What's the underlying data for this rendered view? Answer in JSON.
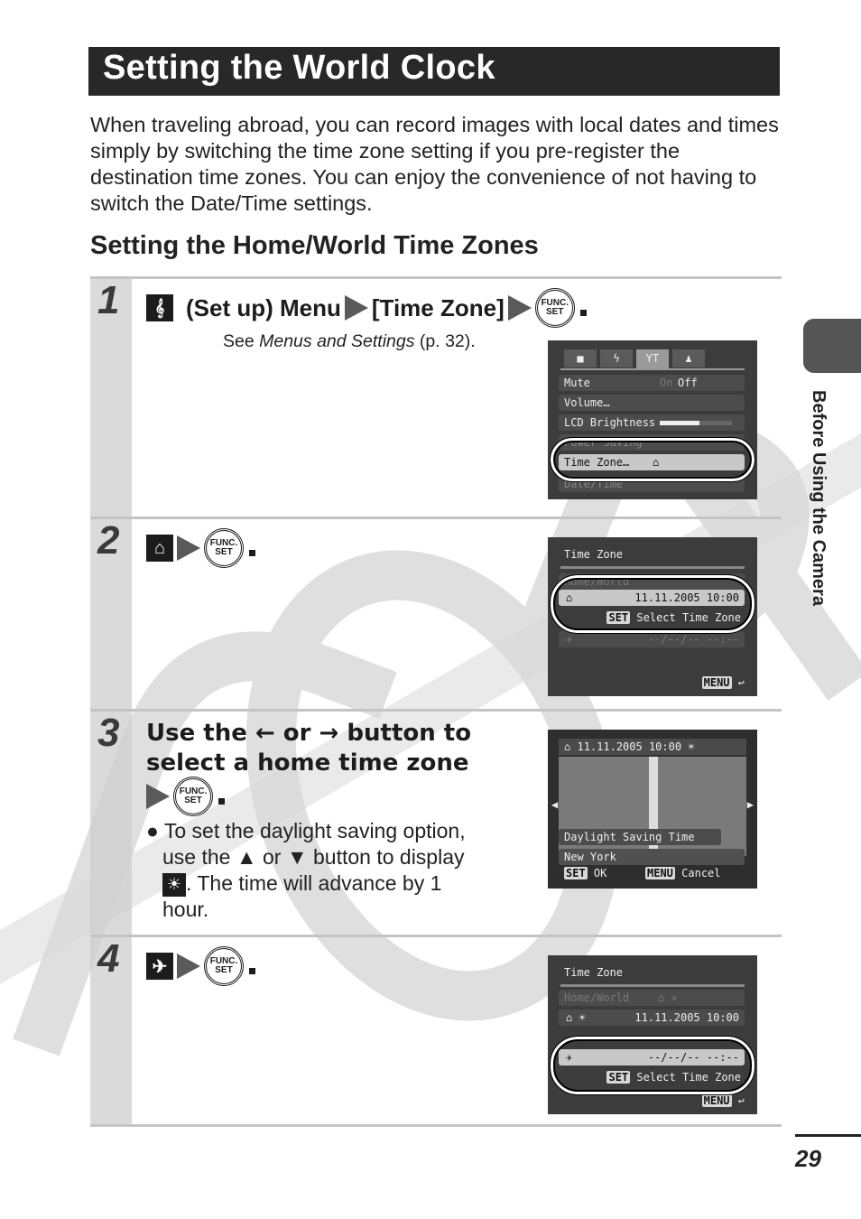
{
  "page": {
    "title": "Setting the World Clock",
    "intro": "When traveling abroad, you can record images with local dates and times simply by switching the time zone setting if you pre-register the destination time zones. You can enjoy the convenience of not having to switch the Date/Time settings.",
    "subheading": "Setting the Home/World Time Zones",
    "side_label": "Before Using the Camera",
    "page_number": "29",
    "watermark": "COPY"
  },
  "steps": [
    {
      "number": "1",
      "instruction_prefix": "(Set up) Menu",
      "instruction_target": "[Time Zone]",
      "icon": "setup-menu-icon",
      "note_prefix": "See ",
      "note_italic": "Menus and Settings",
      "note_suffix": " (p. 32).",
      "screen": {
        "tabs": [
          "camera-icon",
          "flash-icon",
          "setup-icon",
          "mycamera-icon"
        ],
        "rows": [
          {
            "label": "Mute",
            "value_off": "On",
            "value": "Off"
          },
          {
            "label": "Volume…",
            "value": ""
          },
          {
            "label": "LCD Brightness",
            "value": "slider",
            "min": "-",
            "max": "+"
          },
          {
            "label": "Power Saving",
            "value": ""
          },
          {
            "label": "Time Zone…",
            "value": "home-icon"
          },
          {
            "label": "Date/Time",
            "value": ""
          }
        ]
      }
    },
    {
      "number": "2",
      "icon": "home-icon",
      "screen": {
        "title": "Time Zone",
        "rows": [
          {
            "label": "Home/World",
            "value": ""
          },
          {
            "label": "home-icon",
            "value": "11.11.2005 10:00"
          },
          {
            "label": "SET",
            "value": "Select Time Zone"
          },
          {
            "label": "world-icon",
            "value": "--/--/-- --:--"
          }
        ],
        "footer": "MENU"
      }
    },
    {
      "number": "3",
      "instruction_line1_a": "Use the",
      "instruction_line1_b": "or",
      "instruction_line1_c": "button to",
      "instruction_line2": "select a home time zone",
      "bullet_a": "To set the daylight saving option,",
      "bullet_b1": "use the",
      "bullet_b2": "or",
      "bullet_b3": "button to display",
      "bullet_c": ". The time will advance by 1",
      "bullet_d": "hour.",
      "screen": {
        "header": "11.11.2005 10:00",
        "dst_label": "Daylight Saving Time",
        "city": "New York",
        "ok_badge": "SET",
        "ok_label": "OK",
        "cancel_badge": "MENU",
        "cancel_label": "Cancel"
      }
    },
    {
      "number": "4",
      "icon": "airplane-icon",
      "screen": {
        "title": "Time Zone",
        "home_world_label": "Home/World",
        "home_time": "11.11.2005 10:00",
        "world_time": "--/--/-- --:--",
        "set_badge": "SET",
        "set_label": "Select Time Zone",
        "footer": "MENU"
      }
    }
  ]
}
